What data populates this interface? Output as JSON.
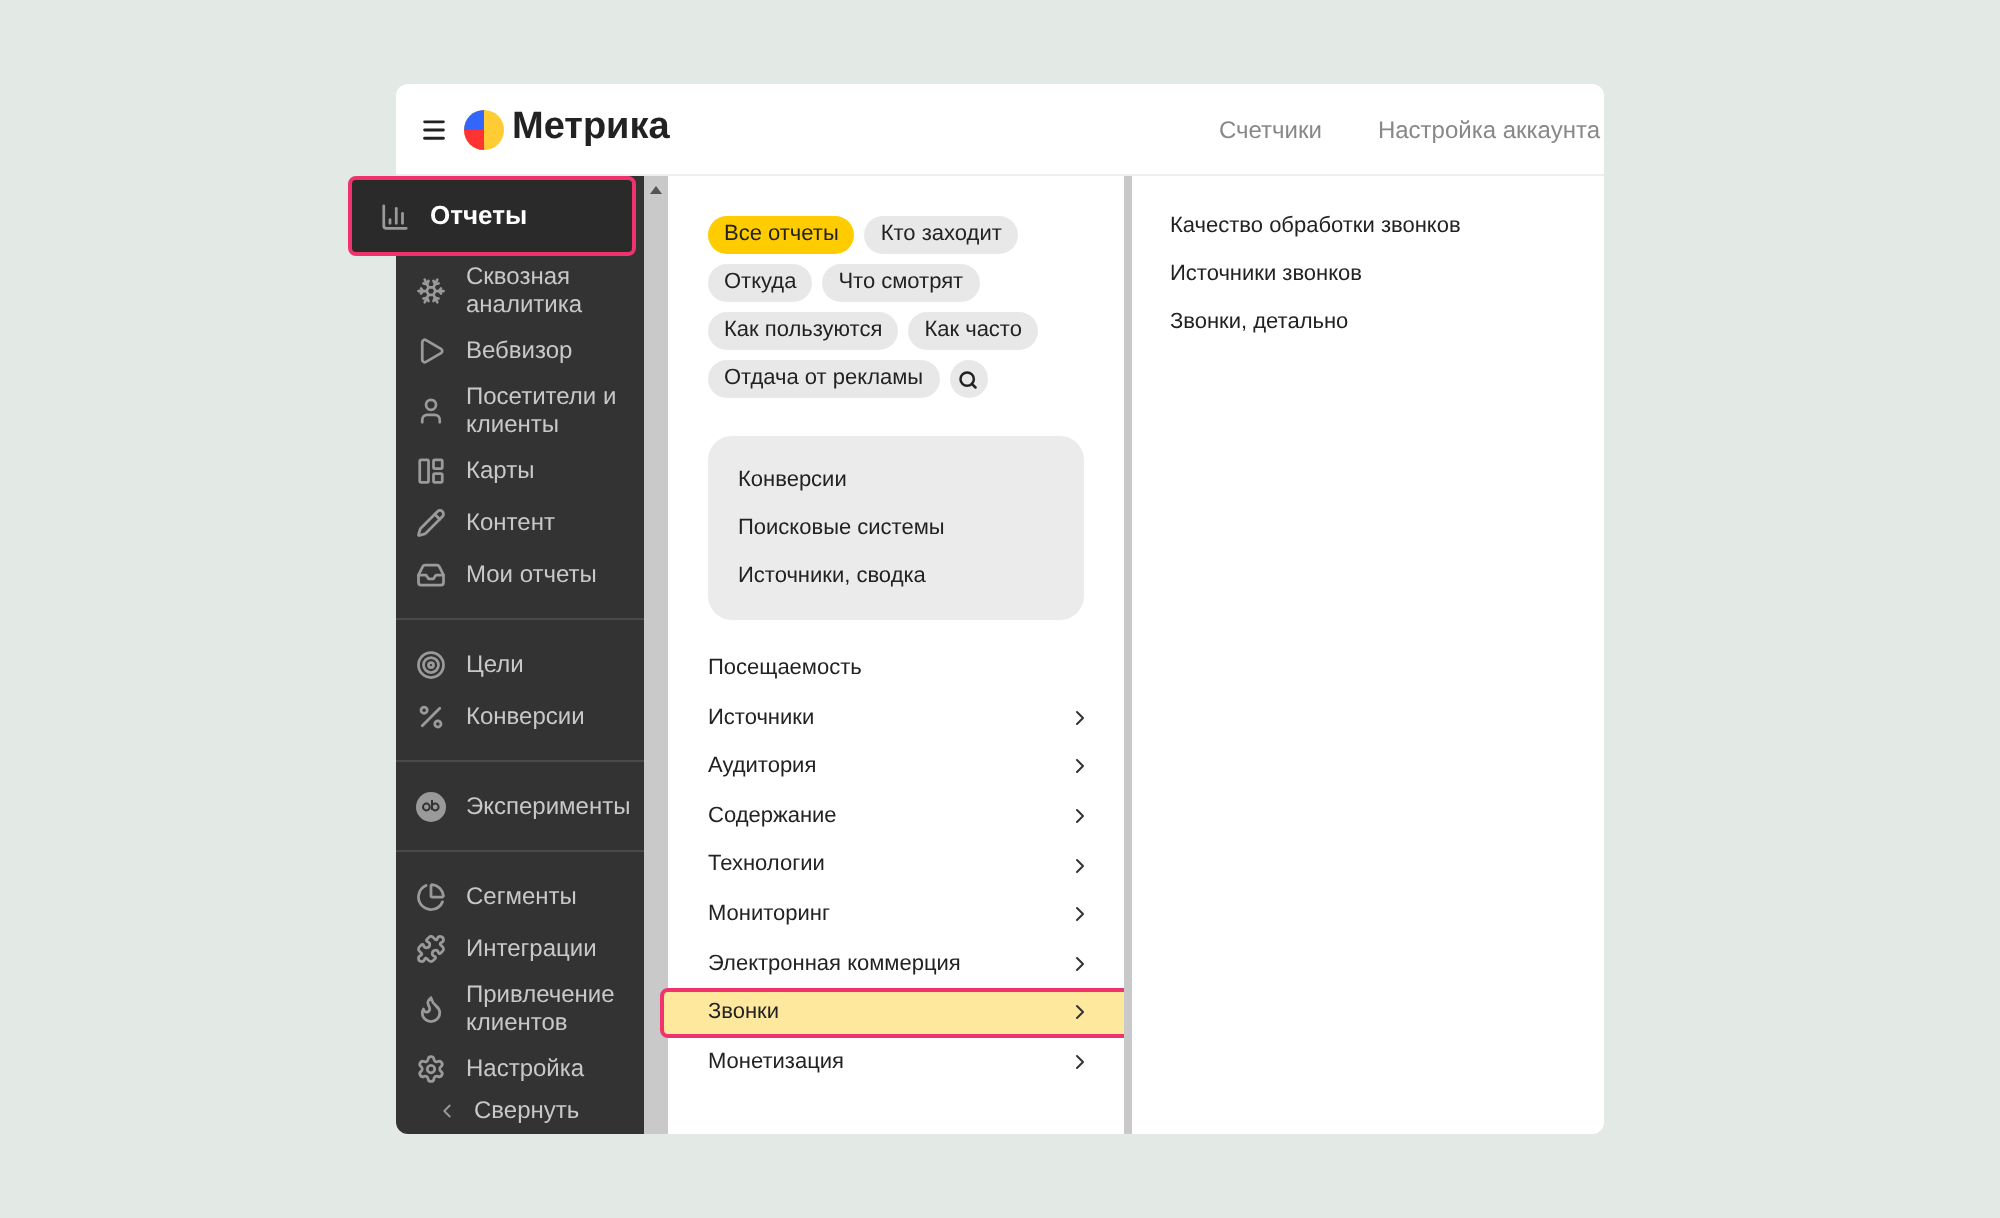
{
  "header": {
    "logo_text": "Метрика",
    "nav": [
      "Счетчики",
      "Настройка аккаунта"
    ]
  },
  "sidebar": {
    "groups": [
      [
        {
          "label": "Отчеты",
          "selected": true,
          "highlighted": true
        },
        {
          "label": "Сквозная аналитика",
          "selected": false,
          "highlighted": false
        },
        {
          "label": "Вебвизор",
          "selected": false,
          "highlighted": false
        },
        {
          "label": "Посетители и клиенты",
          "selected": false,
          "highlighted": false
        },
        {
          "label": "Карты",
          "selected": false,
          "highlighted": false
        },
        {
          "label": "Контент",
          "selected": false,
          "highlighted": false
        },
        {
          "label": "Мои отчеты",
          "selected": false,
          "highlighted": false
        }
      ],
      [
        {
          "label": "Цели",
          "selected": false,
          "highlighted": false
        },
        {
          "label": "Конверсии",
          "selected": false,
          "highlighted": false
        }
      ],
      [
        {
          "label": "Эксперименты",
          "selected": false,
          "highlighted": false
        }
      ],
      [
        {
          "label": "Сегменты",
          "selected": false,
          "highlighted": false
        },
        {
          "label": "Интеграции",
          "selected": false,
          "highlighted": false
        },
        {
          "label": "Привлечение клиентов",
          "selected": false,
          "highlighted": false
        },
        {
          "label": "Настройка",
          "selected": false,
          "highlighted": false
        }
      ]
    ],
    "collapse": "Свернуть"
  },
  "chips": [
    {
      "label": "Все отчеты",
      "selected": true
    },
    {
      "label": "Кто заходит",
      "selected": false
    },
    {
      "label": "Откуда",
      "selected": false
    },
    {
      "label": "Что смотрят",
      "selected": false
    },
    {
      "label": "Как пользуются",
      "selected": false
    },
    {
      "label": "Как часто",
      "selected": false
    },
    {
      "label": "Отдача от рекламы",
      "selected": false
    }
  ],
  "featured": [
    "Конверсии",
    "Поисковые системы",
    "Источники, сводка"
  ],
  "menu": [
    {
      "label": "Посещаемость",
      "has_children": false,
      "selected": false,
      "highlighted": false
    },
    {
      "label": "Источники",
      "has_children": true,
      "selected": false,
      "highlighted": false
    },
    {
      "label": "Аудитория",
      "has_children": true,
      "selected": false,
      "highlighted": false
    },
    {
      "label": "Содержание",
      "has_children": true,
      "selected": false,
      "highlighted": false
    },
    {
      "label": "Технологии",
      "has_children": true,
      "selected": false,
      "highlighted": false
    },
    {
      "label": "Мониторинг",
      "has_children": true,
      "selected": false,
      "highlighted": false
    },
    {
      "label": "Электронная коммерция",
      "has_children": true,
      "selected": false,
      "highlighted": false
    },
    {
      "label": "Звонки",
      "has_children": true,
      "selected": true,
      "highlighted": true
    },
    {
      "label": "Монетизация",
      "has_children": true,
      "selected": false,
      "highlighted": false
    }
  ],
  "submenu": [
    "Качество обработки звонков",
    "Источники звонков",
    "Звонки, детально"
  ]
}
